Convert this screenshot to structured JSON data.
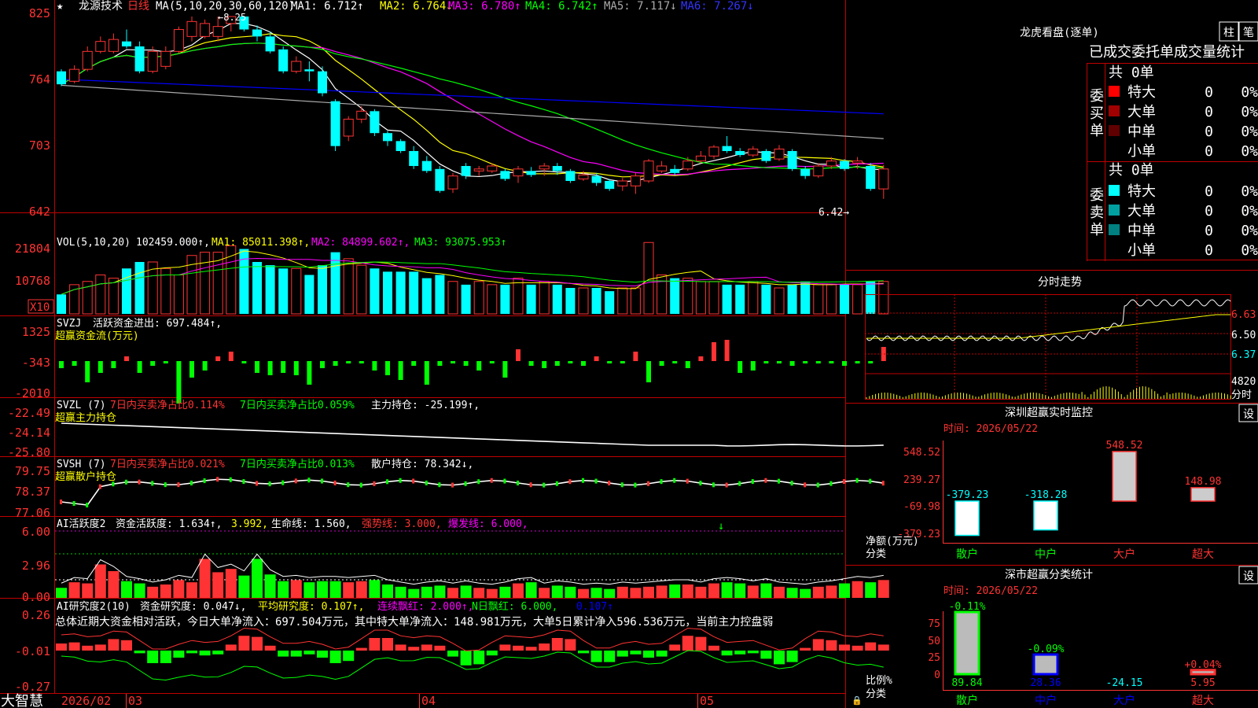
{
  "colors": {
    "up": "#ff3333",
    "down": "#00ffff",
    "grid": "#c00000",
    "axis_text": "#ff3333",
    "white": "#ffffff",
    "yellow": "#ffff00",
    "magenta": "#ff00ff",
    "green": "#00ff00",
    "blue": "#0000ff",
    "gray": "#aaaaaa",
    "darkred": "#800000",
    "teal": "#008080"
  },
  "price_header": {
    "star": "★",
    "stock_name": "龙源技术",
    "period": "日线",
    "ma_params": "MA(5,10,20,30,60,120)",
    "ma_values": [
      {
        "text": "MA1: 6.712↑",
        "color": "#ffffff"
      },
      {
        "text": "MA2: 6.764↓",
        "color": "#ffff00"
      },
      {
        "text": "MA3: 6.780↑",
        "color": "#ff00ff"
      },
      {
        "text": "MA4: 6.742↑",
        "color": "#00ff00"
      },
      {
        "text": "MA5: 7.117↓",
        "color": "#aaaaaa"
      },
      {
        "text": "MA6: 7.267↓",
        "color": "#3333ff"
      }
    ],
    "high_label": "←8.25",
    "low_label": "6.42→"
  },
  "price_axis": [
    "825",
    "764",
    "703",
    "642"
  ],
  "vol_header": {
    "name": "VOL(5,10,20)",
    "items": [
      {
        "text": "102459.000↑,",
        "color": "#ffffff"
      },
      {
        "text": "MA1: 85011.398↑,",
        "color": "#ffff00"
      },
      {
        "text": "MA2: 84899.602↑,",
        "color": "#ff00ff"
      },
      {
        "text": "MA3: 93075.953↑",
        "color": "#00ff00"
      }
    ]
  },
  "vol_axis": [
    "21804",
    "10768"
  ],
  "vol_unit": "X10",
  "svzj_header": {
    "name": "SVZJ",
    "item": "活跃资金进出: 697.484↑,",
    "sub": "超赢资金流(万元)"
  },
  "svzj_axis": [
    "1325",
    "-343",
    "-2010"
  ],
  "svzl_header": {
    "name": "SVZL (7)",
    "a": "7日内买卖净占比0.114%",
    "b": "7日内买卖净占比0.059%",
    "c": "主力持仓: -25.199↑,",
    "sub": "超赢主力持仓"
  },
  "svzl_axis": [
    "-22.49",
    "-24.14",
    "-25.80"
  ],
  "svsh_header": {
    "name": "SVSH (7)",
    "a": "7日内买卖净占比0.021%",
    "b": "7日内买卖净占比0.013%",
    "c": "散户持仓: 78.342↓,",
    "sub": "超赢散户持仓"
  },
  "svsh_axis": [
    "79.75",
    "78.37",
    "77.06"
  ],
  "ai1_header": {
    "name": "AI活跃度2",
    "a": "资金活跃度: 1.634↑,",
    "b": "3.992,",
    "c": "生命线: 1.560,",
    "d": "强势线: 3.000,",
    "e": "爆发线: 6.000,"
  },
  "ai1_axis": [
    "6.00",
    "2.96",
    "0.00"
  ],
  "ai2_header": {
    "name": "AI研究度2(10)",
    "a": "资金研究度: 0.047↓,",
    "b": "平均研究度: 0.107↑,",
    "c": "连续飘红: 2.000↑,",
    "d": "N日飘红: 6.000,",
    "e": "0.107↑"
  },
  "ai2_comment": "总体近期大资金相对活跃，今日大单净流入：697.504万元，其中特大单净流入：148.981万元，大单5日累计净入596.536万元，当前主力控盘弱",
  "ai2_axis": [
    "0.26",
    "-0.01",
    "-0.27"
  ],
  "date_axis": {
    "start": "2026/02",
    "ticks": [
      "03",
      "04",
      "05"
    ]
  },
  "brand": "大智慧",
  "lhb": {
    "title": "龙虎看盘(逐单)",
    "btn_bar": "柱",
    "btn_bi": "笔",
    "tabs": "已成交委托单成交量统计",
    "buy_label": "委买单",
    "sell_label": "委卖单",
    "buy_total": "共 0单",
    "sell_total": "共 0单",
    "buy_rows": [
      {
        "label": "特大",
        "count": "0",
        "pct": "0%",
        "color": "#ff0000"
      },
      {
        "label": "大单",
        "count": "0",
        "pct": "0%",
        "color": "#a00000"
      },
      {
        "label": "中单",
        "count": "0",
        "pct": "0%",
        "color": "#600000"
      },
      {
        "label": "小单",
        "count": "0",
        "pct": "0%",
        "color": ""
      }
    ],
    "sell_rows": [
      {
        "label": "特大",
        "count": "0",
        "pct": "0%",
        "color": "#00ffff"
      },
      {
        "label": "大单",
        "count": "0",
        "pct": "0%",
        "color": "#00a0a0"
      },
      {
        "label": "中单",
        "count": "0",
        "pct": "0%",
        "color": "#008080"
      },
      {
        "label": "小单",
        "count": "0",
        "pct": "0%",
        "color": ""
      }
    ]
  },
  "intraday": {
    "title": "分时走势",
    "axis": [
      "6.63",
      "6.50",
      "6.37"
    ],
    "vol_label": "4820",
    "vol_unit": "分时"
  },
  "sz_monitor": {
    "title": "深圳超赢实时监控",
    "btn": "设",
    "time": "时间: 2026/05/22",
    "axis": [
      "548.52",
      "239.27",
      "-69.98",
      "-379.23"
    ],
    "ylabel": "净额(万元)",
    "xlabel": "分类",
    "bars": [
      {
        "name": "散户",
        "value": -379.23,
        "label": "-379.23",
        "name_color": "#00ff00",
        "label_color": "#00ffff"
      },
      {
        "name": "中户",
        "value": -318.28,
        "label": "-318.28",
        "name_color": "#00ff00",
        "label_color": "#00ffff"
      },
      {
        "name": "大户",
        "value": 548.52,
        "label": "548.52",
        "name_color": "#ff3333",
        "label_color": "#ff3333"
      },
      {
        "name": "超大",
        "value": 148.98,
        "label": "148.98",
        "name_color": "#ff3333",
        "label_color": "#ff3333"
      }
    ]
  },
  "sz_class": {
    "title": "深市超赢分类统计",
    "btn": "设",
    "time": "时间: 2026/05/22",
    "axis": [
      "75",
      "50",
      "25",
      "0"
    ],
    "ylabel": "比例%",
    "xlabel": "分类",
    "bars": [
      {
        "name": "散户",
        "value": 89.84,
        "label": "89.84",
        "change": "-0.11%",
        "name_color": "#00ff00",
        "change_color": "#00ff00",
        "label_color": "#00ff00"
      },
      {
        "name": "中户",
        "value": 28.36,
        "label": "28.36",
        "change": "-0.09%",
        "name_color": "#0000ff",
        "change_color": "#00ff00",
        "label_color": "#0000ff"
      },
      {
        "name": "大户",
        "value": -24.15,
        "label": "-24.15",
        "change": "",
        "name_color": "#0000ff",
        "change_color": "#00ff00",
        "label_color": "#00ffff"
      },
      {
        "name": "超大",
        "value": 5.95,
        "label": "5.95",
        "change": "+0.04%",
        "name_color": "#ff3333",
        "change_color": "#ff3333",
        "label_color": "#ff3333"
      }
    ]
  },
  "chart_data": [
    {
      "type": "candlestick",
      "title": "龙源技术 日线",
      "ylim": [
        6.3,
        8.4
      ],
      "bars": [
        [
          7.7,
          7.57,
          7.72,
          7.55
        ],
        [
          7.6,
          7.72,
          7.76,
          7.58
        ],
        [
          7.72,
          7.9,
          7.95,
          7.7
        ],
        [
          7.9,
          8.0,
          8.05,
          7.88
        ],
        [
          7.9,
          8.02,
          8.08,
          7.88
        ],
        [
          8.0,
          7.95,
          8.12,
          7.93
        ],
        [
          7.95,
          7.7,
          8.0,
          7.68
        ],
        [
          7.7,
          7.9,
          7.95,
          7.68
        ],
        [
          7.75,
          7.9,
          7.95,
          7.72
        ],
        [
          7.9,
          8.12,
          8.15,
          7.88
        ],
        [
          8.05,
          8.2,
          8.25,
          8.0
        ],
        [
          8.05,
          8.18,
          8.22,
          8.03
        ],
        [
          8.05,
          8.15,
          8.25,
          8.0
        ],
        [
          8.18,
          8.25,
          8.25,
          8.1
        ],
        [
          8.25,
          8.12,
          8.25,
          8.1
        ],
        [
          8.12,
          8.05,
          8.16,
          8.0
        ],
        [
          8.05,
          7.9,
          8.1,
          7.88
        ],
        [
          7.92,
          7.7,
          7.95,
          7.68
        ],
        [
          7.7,
          7.8,
          7.85,
          7.68
        ],
        [
          7.72,
          7.7,
          7.8,
          7.6
        ],
        [
          7.7,
          7.48,
          7.75,
          7.45
        ],
        [
          7.4,
          6.95,
          7.42,
          6.9
        ],
        [
          7.05,
          7.22,
          7.25,
          7.0
        ],
        [
          7.22,
          7.3,
          7.35,
          7.18
        ],
        [
          7.3,
          7.08,
          7.32,
          7.05
        ],
        [
          7.08,
          7.0,
          7.1,
          6.95
        ],
        [
          7.0,
          6.9,
          7.02,
          6.88
        ],
        [
          6.9,
          6.75,
          6.95,
          6.72
        ],
        [
          6.8,
          6.7,
          6.85,
          6.68
        ],
        [
          6.72,
          6.5,
          6.75,
          6.48
        ],
        [
          6.52,
          6.65,
          6.68,
          6.48
        ],
        [
          6.75,
          6.65,
          6.78,
          6.62
        ],
        [
          6.7,
          6.72,
          6.75,
          6.65
        ],
        [
          6.7,
          6.75,
          6.78,
          6.68
        ],
        [
          6.7,
          6.62,
          6.72,
          6.6
        ],
        [
          6.65,
          6.72,
          6.75,
          6.58
        ],
        [
          6.7,
          6.66,
          6.74,
          6.64
        ],
        [
          6.72,
          6.75,
          6.78,
          6.65
        ],
        [
          6.75,
          6.7,
          6.78,
          6.66
        ],
        [
          6.7,
          6.6,
          6.72,
          6.58
        ],
        [
          6.62,
          6.66,
          6.7,
          6.6
        ],
        [
          6.65,
          6.58,
          6.68,
          6.55
        ],
        [
          6.6,
          6.52,
          6.62,
          6.5
        ],
        [
          6.55,
          6.6,
          6.63,
          6.5
        ],
        [
          6.55,
          6.65,
          6.68,
          6.47
        ],
        [
          6.6,
          6.8,
          6.82,
          6.58
        ],
        [
          6.7,
          6.75,
          6.8,
          6.68
        ],
        [
          6.72,
          6.68,
          6.76,
          6.66
        ],
        [
          6.72,
          6.8,
          6.84,
          6.7
        ],
        [
          6.8,
          6.85,
          6.9,
          6.78
        ],
        [
          6.85,
          6.94,
          6.96,
          6.82
        ],
        [
          6.95,
          6.9,
          7.05,
          6.88
        ],
        [
          6.9,
          6.86,
          6.93,
          6.84
        ],
        [
          6.86,
          6.92,
          6.95,
          6.84
        ],
        [
          6.9,
          6.8,
          6.92,
          6.78
        ],
        [
          6.82,
          6.92,
          6.96,
          6.8
        ],
        [
          6.9,
          6.72,
          6.92,
          6.7
        ],
        [
          6.72,
          6.65,
          6.75,
          6.62
        ],
        [
          6.65,
          6.75,
          6.78,
          6.63
        ],
        [
          6.75,
          6.8,
          6.84,
          6.72
        ],
        [
          6.8,
          6.72,
          6.82,
          6.7
        ],
        [
          6.78,
          6.8,
          6.84,
          6.72
        ],
        [
          6.75,
          6.52,
          6.78,
          6.5
        ],
        [
          6.52,
          6.72,
          6.76,
          6.42
        ]
      ],
      "annotations": {
        "high": 8.25,
        "low": 6.42
      }
    },
    {
      "type": "bar",
      "title": "VOL(5,10,20)",
      "values": [
        6,
        9,
        10,
        12,
        11,
        14,
        16,
        16,
        14,
        12,
        18,
        19,
        19,
        21,
        20,
        16,
        15,
        14,
        14,
        12,
        15,
        19,
        17,
        15,
        14,
        13,
        13,
        13,
        11,
        12,
        10,
        9,
        10,
        9,
        9,
        11,
        9,
        10,
        9,
        8,
        8,
        8,
        7,
        8,
        8,
        22,
        12,
        11,
        11,
        10,
        10,
        9,
        9,
        10,
        9,
        8,
        9,
        10,
        9,
        9,
        9,
        9,
        10,
        10
      ]
    },
    {
      "type": "bar",
      "title": "SVZJ",
      "values": [
        -300,
        -200,
        -900,
        -500,
        -300,
        200,
        -500,
        -200,
        -100,
        -1800,
        -700,
        -400,
        200,
        400,
        -100,
        -500,
        -600,
        -500,
        -600,
        -1000,
        -300,
        -200,
        -100,
        -100,
        -400,
        -600,
        -800,
        -200,
        -1000,
        -200,
        -100,
        -200,
        -400,
        -100,
        -700,
        500,
        -200,
        -300,
        -200,
        -100,
        -200,
        200,
        -100,
        -100,
        400,
        -900,
        -200,
        -100,
        -300,
        200,
        800,
        900,
        -500,
        -400,
        -100,
        -100,
        -200,
        -100,
        -100,
        -100,
        -200,
        -100,
        -100,
        600
      ]
    },
    {
      "type": "bar",
      "title": "AI活跃度2",
      "values": [
        0.9,
        1.4,
        1.3,
        3.0,
        2.4,
        1.5,
        1.3,
        1.0,
        1.2,
        1.6,
        1.4,
        3.5,
        2.3,
        2.6,
        2.0,
        3.5,
        2.1,
        1.5,
        1.6,
        1.4,
        1.5,
        1.5,
        1.4,
        1.5,
        1.6,
        1.2,
        1.0,
        0.8,
        1.0,
        1.1,
        0.9,
        1.1,
        0.9,
        0.8,
        1.0,
        1.3,
        1.4,
        0.9,
        1.1,
        1.0,
        0.8,
        0.9,
        0.8,
        1.0,
        0.9,
        1.0,
        1.1,
        1.2,
        1.2,
        1.0,
        1.3,
        1.4,
        1.3,
        1.1,
        1.3,
        1.0,
        0.9,
        0.8,
        1.0,
        1.1,
        1.3,
        1.5,
        1.4,
        1.6
      ]
    }
  ]
}
